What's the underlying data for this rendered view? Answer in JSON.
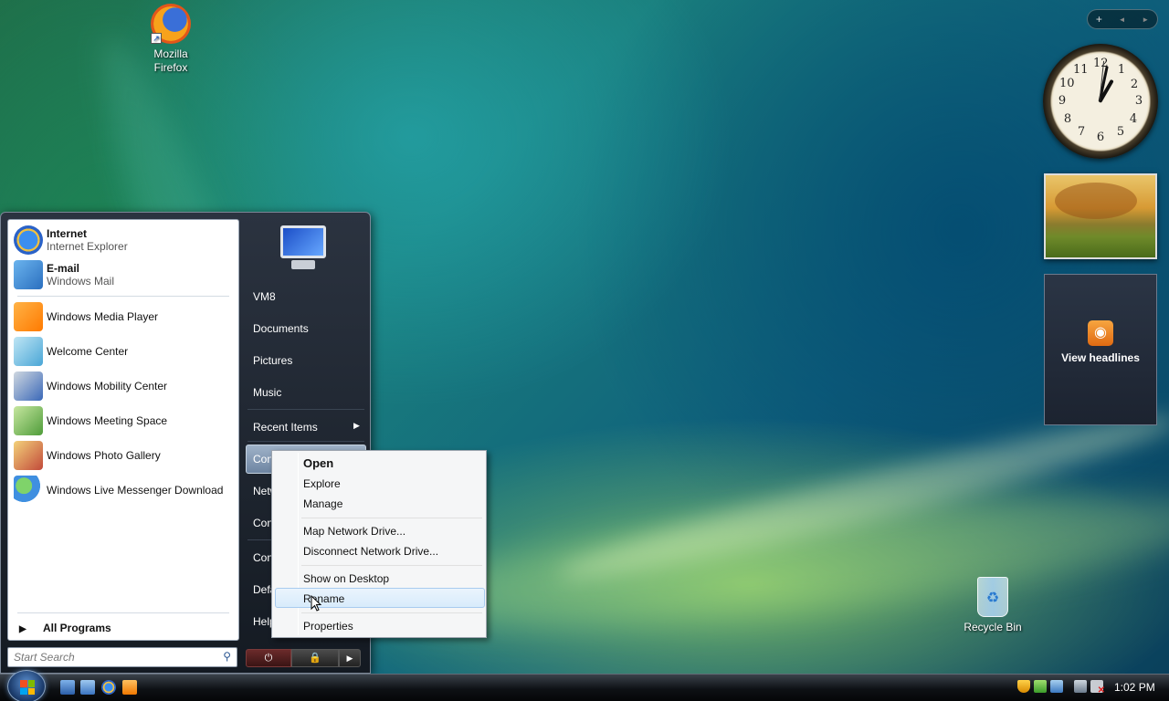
{
  "desktop": {
    "icons": [
      {
        "label": "Mozilla",
        "label2": "Firefox"
      },
      {
        "label": "Recycle Bin"
      }
    ]
  },
  "sidebar": {
    "controls": {
      "add": "+",
      "prev": "◄",
      "next": "►"
    },
    "clock_numbers": [
      "12",
      "1",
      "2",
      "3",
      "4",
      "5",
      "6",
      "7",
      "8",
      "9",
      "10",
      "11"
    ],
    "feed_label": "View headlines"
  },
  "start_menu": {
    "pinned": [
      {
        "title": "Internet",
        "subtitle": "Internet Explorer"
      },
      {
        "title": "E-mail",
        "subtitle": "Windows Mail"
      }
    ],
    "recent": [
      "Windows Media Player",
      "Welcome Center",
      "Windows Mobility Center",
      "Windows Meeting Space",
      "Windows Photo Gallery",
      "Windows Live Messenger Download"
    ],
    "all_programs": "All Programs",
    "search_placeholder": "Start Search",
    "right_links": [
      "VM8",
      "Documents",
      "Pictures",
      "Music",
      "Recent Items",
      "Con",
      "Netw",
      "Con",
      "Con",
      "Defa",
      "Help"
    ]
  },
  "context_menu": {
    "items": [
      "Open",
      "Explore",
      "Manage",
      "Map Network Drive...",
      "Disconnect Network Drive...",
      "Show on Desktop",
      "Rename",
      "Properties"
    ],
    "highlighted": "Rename"
  },
  "taskbar": {
    "time": "1:02 PM"
  }
}
